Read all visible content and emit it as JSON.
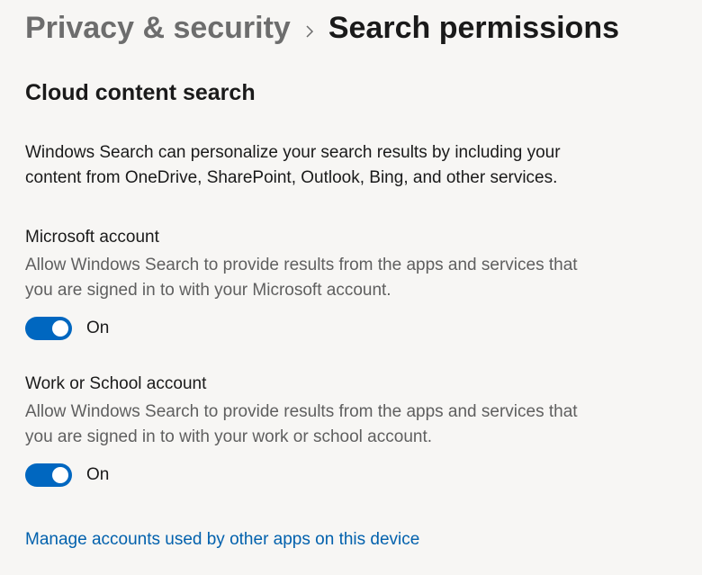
{
  "breadcrumb": {
    "parent": "Privacy & security",
    "current": "Search permissions"
  },
  "section": {
    "title": "Cloud content search",
    "description": "Windows Search can personalize your search results by including your content from OneDrive, SharePoint, Outlook, Bing, and other services."
  },
  "settings": [
    {
      "title": "Microsoft account",
      "description": "Allow Windows Search to provide results from the apps and services that you are signed in to with your Microsoft account.",
      "toggle_state": "On"
    },
    {
      "title": "Work or School account",
      "description": "Allow Windows Search to provide results from the apps and services that you are signed in to with your work or school account.",
      "toggle_state": "On"
    }
  ],
  "link": {
    "manage_accounts": "Manage accounts used by other apps on this device"
  }
}
